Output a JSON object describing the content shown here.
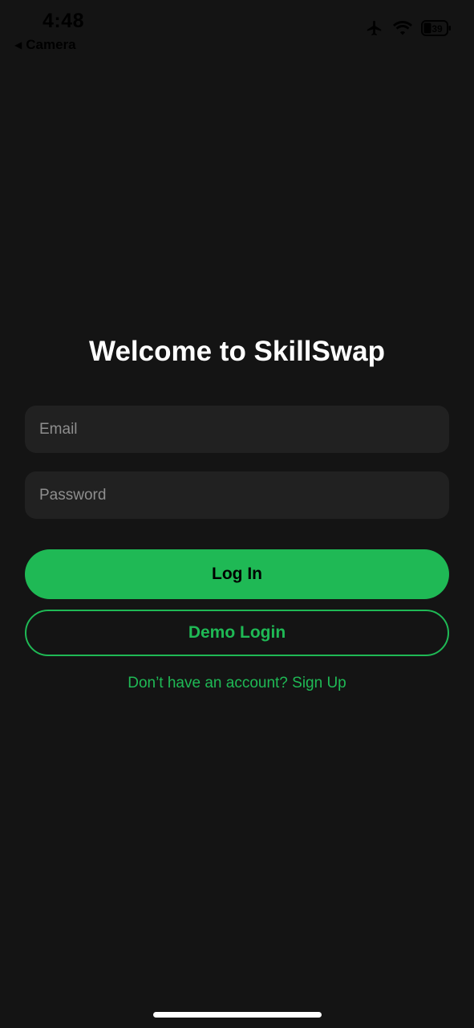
{
  "status_bar": {
    "time": "4:48",
    "back_app": "Camera",
    "battery_level": "39",
    "icons": [
      "airplane-icon",
      "wifi-icon",
      "battery-icon"
    ]
  },
  "login": {
    "title": "Welcome to SkillSwap",
    "email_placeholder": "Email",
    "password_placeholder": "Password",
    "login_label": "Log In",
    "demo_label": "Demo Login",
    "signup_text": "Don’t have an account? Sign Up"
  },
  "colors": {
    "background": "#141414",
    "field_background": "#212121",
    "accent": "#1fb955"
  }
}
